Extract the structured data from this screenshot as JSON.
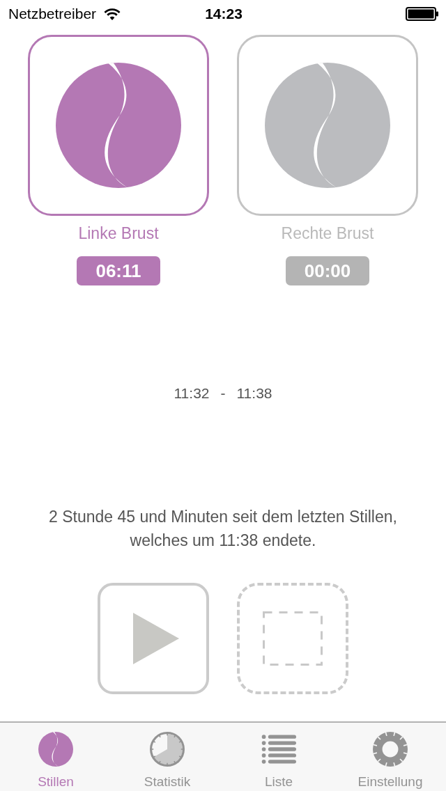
{
  "status_bar": {
    "carrier": "Netzbetreiber",
    "time": "14:23"
  },
  "sides": [
    {
      "label": "Linke Brust",
      "timer": "06:11",
      "selected": true
    },
    {
      "label": "Rechte Brust",
      "timer": "00:00",
      "selected": false
    }
  ],
  "session": {
    "start": "11:32",
    "separator": "-",
    "end": "11:38"
  },
  "message": "2 Stunde 45 und Minuten seit dem letzten Stillen, welches um 11:38 endete.",
  "controls": [
    {
      "kind": "play",
      "disabled": false
    },
    {
      "kind": "stop",
      "disabled": true
    }
  ],
  "tabs": [
    {
      "kind": "feeding",
      "label": "Stillen",
      "selected": true
    },
    {
      "kind": "statistics",
      "label": "Statistik",
      "selected": false
    },
    {
      "kind": "list",
      "label": "Liste",
      "selected": false
    },
    {
      "kind": "settings",
      "label": "Einstellung",
      "selected": false
    }
  ]
}
